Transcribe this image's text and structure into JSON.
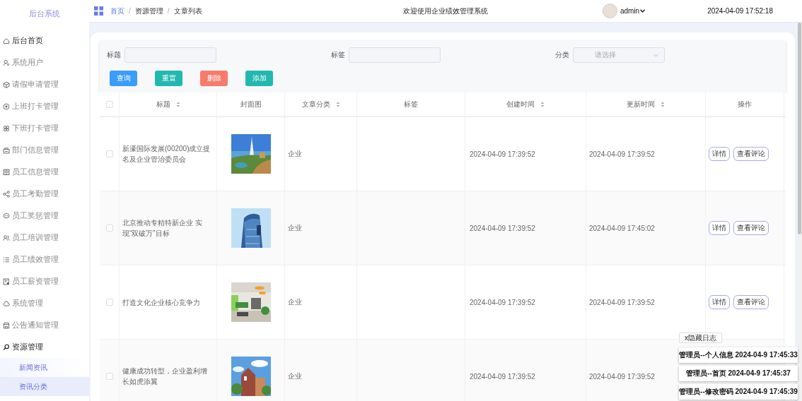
{
  "sidebar": {
    "title": "后台系统",
    "items": [
      {
        "label": "后台首页",
        "selected": false
      },
      {
        "label": "系统用户",
        "selected": false
      },
      {
        "label": "请假申请管理",
        "selected": false
      },
      {
        "label": "上班打卡管理",
        "selected": false
      },
      {
        "label": "下班打卡管理",
        "selected": false
      },
      {
        "label": "部门信息管理",
        "selected": false
      },
      {
        "label": "员工信息管理",
        "selected": false
      },
      {
        "label": "员工考勤管理",
        "selected": false
      },
      {
        "label": "员工奖惩管理",
        "selected": false
      },
      {
        "label": "员工培训管理",
        "selected": false
      },
      {
        "label": "员工绩效管理",
        "selected": false
      },
      {
        "label": "员工薪资管理",
        "selected": false
      },
      {
        "label": "系统管理",
        "selected": false
      },
      {
        "label": "公告通知管理",
        "selected": false
      },
      {
        "label": "资源管理",
        "selected": false,
        "expanded": true,
        "children": [
          {
            "label": "新闻资讯",
            "selected": false
          },
          {
            "label": "资讯分类",
            "selected": true
          }
        ]
      }
    ]
  },
  "header": {
    "breadcrumb": [
      "首页",
      "资源管理",
      "文章列表"
    ],
    "breadcrumb_separator": "/",
    "title": "欢迎使用企业绩效管理系统",
    "user": "admin",
    "datetime": "2024-04-09 17:52:18"
  },
  "search": {
    "fields": [
      {
        "label": "标题",
        "kind": "input"
      },
      {
        "label": "标签",
        "kind": "input"
      },
      {
        "label": "分类",
        "kind": "select",
        "placeholder": "请选择"
      }
    ],
    "buttons": [
      {
        "label": "查询",
        "color": "#3a9dfb"
      },
      {
        "label": "重置",
        "color": "#22b8b0"
      },
      {
        "label": "删除",
        "color": "#f87a6a"
      },
      {
        "label": "添加",
        "color": "#22b8b0"
      }
    ]
  },
  "table": {
    "select_all": {
      "checked": false
    },
    "columns": [
      {
        "label": "标题",
        "sortable": true
      },
      {
        "label": "封面图",
        "sortable": false
      },
      {
        "label": "文章分类",
        "sortable": true
      },
      {
        "label": "标签",
        "sortable": false
      },
      {
        "label": "创建时间",
        "sortable": true
      },
      {
        "label": "更新时间",
        "sortable": true
      },
      {
        "label": "操作",
        "sortable": false
      }
    ],
    "rows": [
      {
        "selected": false,
        "title": "新濠国际发展(00200)成立提名及企业管治委员会",
        "cover": {
          "kind": "picture"
        },
        "category": "企业",
        "created": "2024-04-09 17:39:52",
        "updated": "2024-04-09 17:39:52",
        "actions": [
          "详情",
          "查看评论"
        ]
      },
      {
        "selected": false,
        "title": "北京推动专精特新企业 实现“双破万”目标",
        "cover": {
          "kind": "picture"
        },
        "category": "企业",
        "created": "2024-04-09 17:39:52",
        "updated": "2024-04-09 17:45:02",
        "actions": [
          "详情",
          "查看评论"
        ]
      },
      {
        "selected": false,
        "title": "打造文化企业核心竞争力",
        "cover": {
          "kind": "picture"
        },
        "category": "企业",
        "created": "2024-04-09 17:39:52",
        "updated": "2024-04-09 17:39:52",
        "actions": [
          "详情",
          "查看评论"
        ]
      },
      {
        "selected": false,
        "title": "健康成功转型，企业盈利增长如虎添翼",
        "cover": {
          "kind": "picture"
        },
        "category": "企业",
        "created": "2024-04-09 17:39:52",
        "updated": "2024-04-09 17:39:52"
      }
    ]
  },
  "log": {
    "toggle": "x隐藏日志",
    "entries": [
      "管理员--个人信息 2024-04-9 17:45:33",
      "管理员--首页 2024-04-9 17:45:37",
      "管理员--修改密码 2024-04-9 17:45:39"
    ]
  }
}
